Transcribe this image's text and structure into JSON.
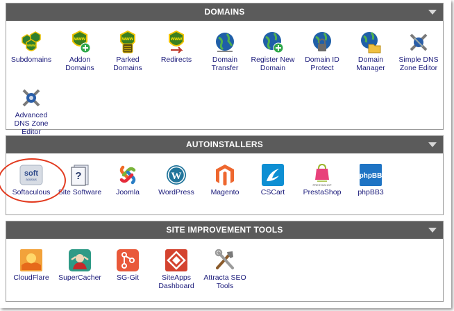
{
  "domains": {
    "title": "DOMAINS",
    "items": [
      {
        "label": "Subdomains",
        "icon": "www-badges-icon"
      },
      {
        "label": "Addon Domains",
        "icon": "www-plus-icon"
      },
      {
        "label": "Parked Domains",
        "icon": "www-parked-icon"
      },
      {
        "label": "Redirects",
        "icon": "www-redirect-icon"
      },
      {
        "label": "Domain Transfer",
        "icon": "globe-transfer-icon"
      },
      {
        "label": "Register New Domain",
        "icon": "globe-plus-icon"
      },
      {
        "label": "Domain ID Protect",
        "icon": "globe-lock-icon"
      },
      {
        "label": "Domain Manager",
        "icon": "globe-folder-icon"
      },
      {
        "label": "Simple DNS Zone Editor",
        "icon": "dns-tools-icon"
      },
      {
        "label": "Advanced DNS Zone Editor",
        "icon": "dns-advanced-icon"
      }
    ]
  },
  "autoinstallers": {
    "title": "AUTOINSTALLERS",
    "items": [
      {
        "label": "Softaculous",
        "icon": "softaculous-icon",
        "logo_text": "soft",
        "logo_sub": "aculous"
      },
      {
        "label": "Site Software",
        "icon": "site-software-icon"
      },
      {
        "label": "Joomla",
        "icon": "joomla-icon"
      },
      {
        "label": "WordPress",
        "icon": "wordpress-icon"
      },
      {
        "label": "Magento",
        "icon": "magento-icon"
      },
      {
        "label": "CSCart",
        "icon": "cscart-icon"
      },
      {
        "label": "PrestaShop",
        "icon": "prestashop-icon"
      },
      {
        "label": "phpBB3",
        "icon": "phpbb-icon",
        "logo_text": "phpBB"
      }
    ]
  },
  "site_improvement": {
    "title": "SITE IMPROVEMENT TOOLS",
    "items": [
      {
        "label": "CloudFlare",
        "icon": "cloudflare-icon"
      },
      {
        "label": "SuperCacher",
        "icon": "supercacher-icon"
      },
      {
        "label": "SG-Git",
        "icon": "sg-git-icon"
      },
      {
        "label": "SiteApps Dashboard",
        "icon": "siteapps-icon"
      },
      {
        "label": "Attracta SEO Tools",
        "icon": "attracta-tools-icon"
      }
    ]
  },
  "colors": {
    "header_bg": "#5b5b5b",
    "label_text": "#1a1a7a",
    "highlight": "#e23a1f"
  }
}
